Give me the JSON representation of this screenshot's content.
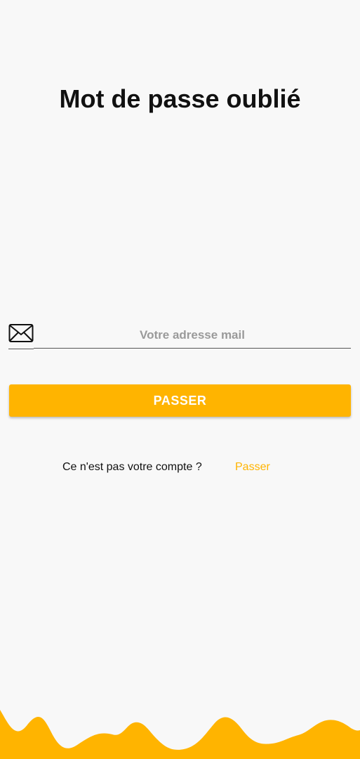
{
  "page": {
    "title": "Mot de passe oublié"
  },
  "email": {
    "icon": "mail-icon",
    "placeholder": "Votre adresse mail",
    "value": ""
  },
  "submit": {
    "label": "PASSER"
  },
  "footer": {
    "question": "Ce n'est pas votre compte ?",
    "link_label": "Passer"
  },
  "colors": {
    "accent": "#ffb400",
    "background": "#f8f8f8",
    "text": "#111111",
    "placeholder": "#9a9a9a"
  }
}
